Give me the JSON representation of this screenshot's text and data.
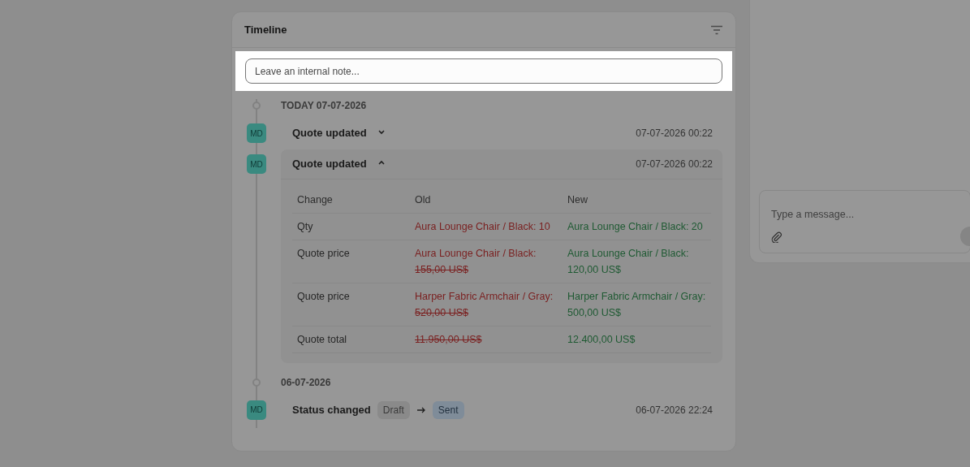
{
  "timeline": {
    "title": "Timeline",
    "note_placeholder": "Leave an internal note...",
    "groups": [
      {
        "date": "TODAY 07-07-2026",
        "events": [
          {
            "kind": "update",
            "initials": "MD",
            "title": "Quote updated",
            "expanded": false,
            "time": "07-07-2026 00:22"
          },
          {
            "kind": "update",
            "initials": "MD",
            "title": "Quote updated",
            "expanded": true,
            "time": "07-07-2026 00:22",
            "columns": [
              "Change",
              "Old",
              "New"
            ],
            "rows": [
              {
                "change": "Qty",
                "old": {
                  "text": "Aura Lounge Chair / Black: 10"
                },
                "new": "Aura Lounge Chair / Black: 20"
              },
              {
                "change": "Quote price",
                "old": {
                  "text": "Aura Lounge Chair / Black:",
                  "struck": "155,00 US$"
                },
                "new": "Aura Lounge Chair / Black: 120,00 US$"
              },
              {
                "change": "Quote price",
                "old": {
                  "text": "Harper Fabric Armchair / Gray:",
                  "struck": "520,00 US$"
                },
                "new": "Harper Fabric Armchair / Gray: 500,00 US$"
              },
              {
                "change": "Quote total",
                "old": {
                  "struck": "11.950,00 US$"
                },
                "new": "12.400,00 US$"
              }
            ]
          }
        ]
      },
      {
        "date": "06-07-2026",
        "events": [
          {
            "kind": "status",
            "initials": "MD",
            "title": "Status changed",
            "from": "Draft",
            "to": "Sent",
            "time": "06-07-2026 22:24"
          }
        ]
      }
    ]
  },
  "chat": {
    "placeholder": "Type a message..."
  }
}
